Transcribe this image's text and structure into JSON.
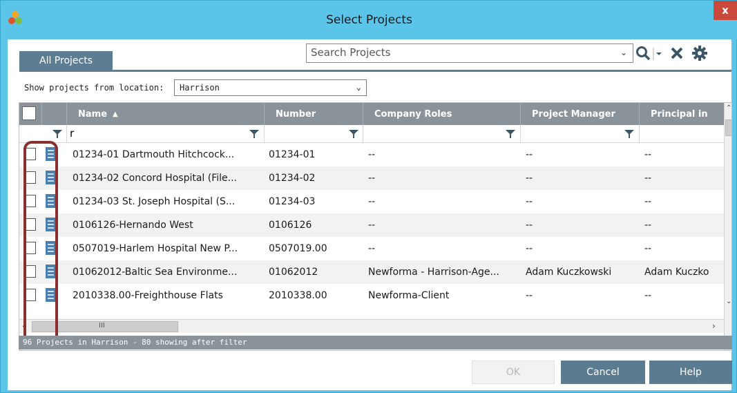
{
  "window": {
    "title": "Select Projects",
    "close_label": "x"
  },
  "tabs": {
    "all_projects": "All Projects"
  },
  "search": {
    "placeholder": "Search Projects"
  },
  "location": {
    "label": "Show projects from location:",
    "value": "Harrison"
  },
  "grid": {
    "columns": [
      "Name",
      "Number",
      "Company Roles",
      "Project Manager",
      "Principal in"
    ],
    "filter_value": "r",
    "rows": [
      {
        "name": "01234-01 Dartmouth Hitchcock...",
        "number": "01234-01",
        "roles": "--",
        "manager": "--",
        "principal": "--"
      },
      {
        "name": "01234-02 Concord Hospital (File...",
        "number": "01234-02",
        "roles": "--",
        "manager": "--",
        "principal": "--"
      },
      {
        "name": "01234-03 St. Joseph Hospital (S...",
        "number": "01234-03",
        "roles": "--",
        "manager": "--",
        "principal": "--"
      },
      {
        "name": "0106126-Hernando West",
        "number": "0106126",
        "roles": "--",
        "manager": "--",
        "principal": "--"
      },
      {
        "name": "0507019-Harlem Hospital New P...",
        "number": "0507019.00",
        "roles": "--",
        "manager": "--",
        "principal": "--"
      },
      {
        "name": "01062012-Baltic Sea Environme...",
        "number": "01062012",
        "roles": "Newforma - Harrison-Age...",
        "manager": "Adam Kuczkowski",
        "principal": "Adam Kuczko"
      },
      {
        "name": "2010338.00-Freighthouse Flats",
        "number": "2010338.00",
        "roles": "Newforma-Client",
        "manager": "--",
        "principal": "--"
      }
    ]
  },
  "status": "96 Projects in Harrison - 80 showing after filter",
  "buttons": {
    "ok": "OK",
    "cancel": "Cancel",
    "help": "Help"
  },
  "scrollbar": {
    "h_thumb_label": "III"
  },
  "colors": {
    "titlebar": "#5ac5e8",
    "header": "#8a9399",
    "button": "#5a7b90",
    "close": "#c94a3c",
    "highlight_box": "#8b2e2e"
  }
}
